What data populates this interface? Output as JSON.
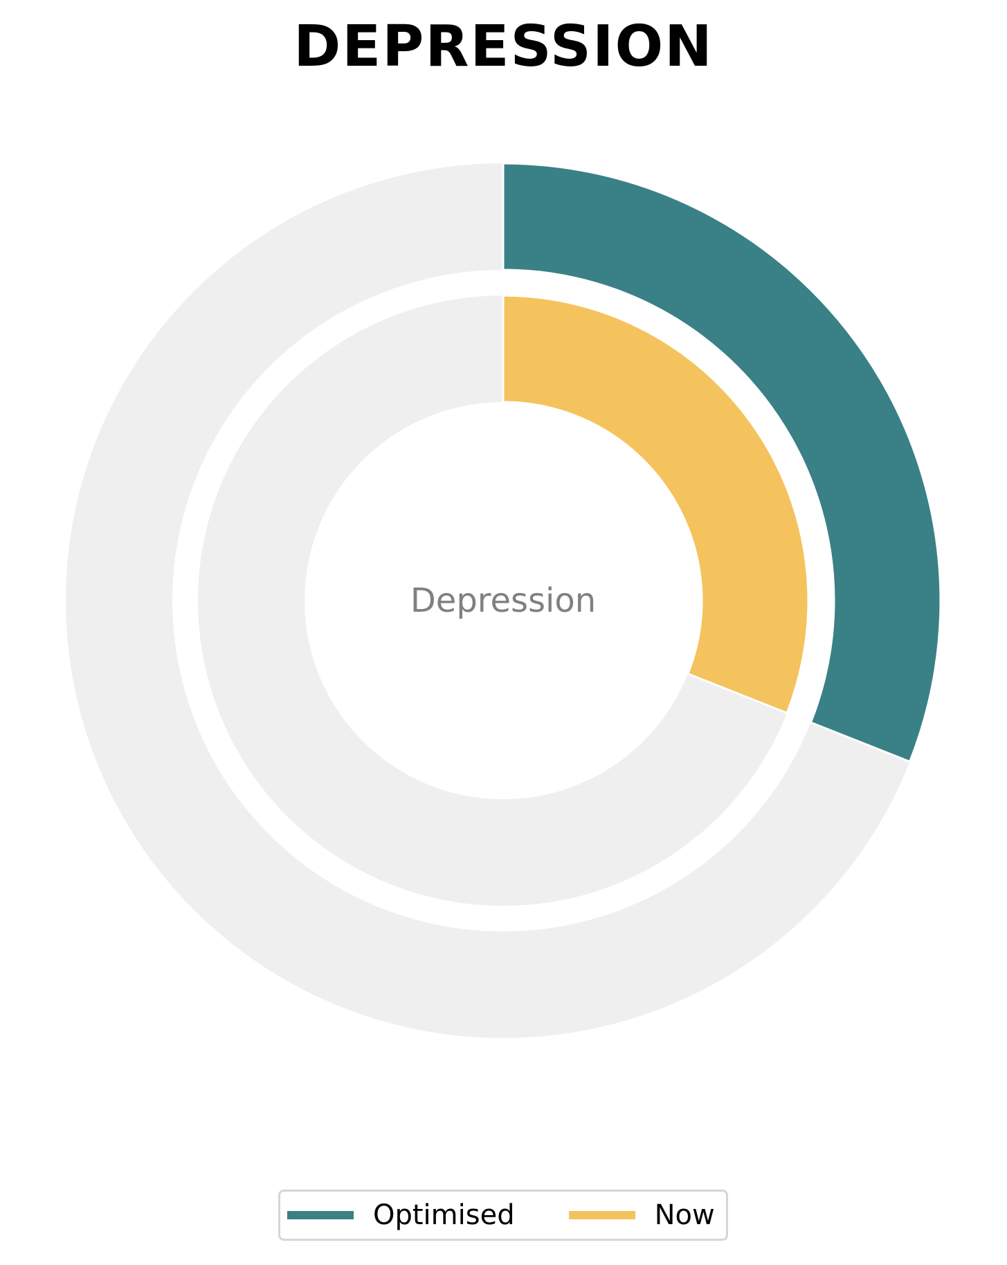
{
  "chart_data": {
    "type": "pie",
    "variant": "nested-donut",
    "title": "DEPRESSION",
    "center_label": "Depression",
    "max_value": 100,
    "start_angle": "12 o'clock",
    "direction": "clockwise",
    "track_color": "#efefef",
    "series": [
      {
        "name": "Optimised",
        "ring": "outer",
        "value": 31,
        "color": "#3a8087"
      },
      {
        "name": "Now",
        "ring": "inner",
        "value": 31,
        "color": "#f4c35e"
      }
    ],
    "legend": {
      "position": "bottom-center",
      "entries": [
        "Optimised",
        "Now"
      ]
    }
  }
}
